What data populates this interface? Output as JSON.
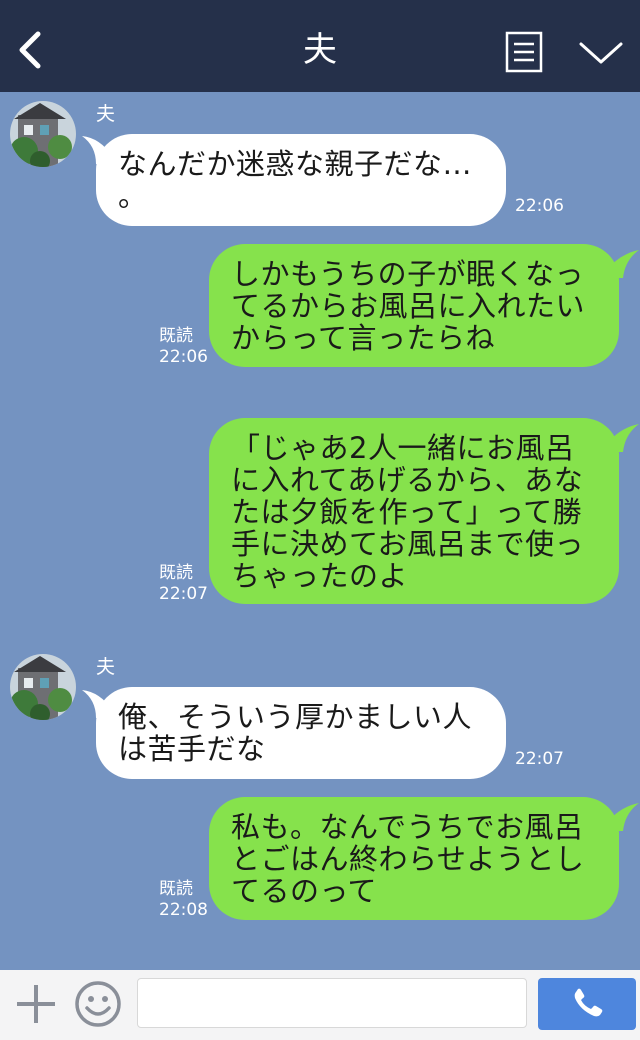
{
  "header": {
    "title": "夫"
  },
  "messages": [
    {
      "direction": "in",
      "sender": "夫",
      "text": "なんだか迷惑な親子だな…\n。",
      "time": "22:06"
    },
    {
      "direction": "out",
      "status": "既読",
      "text": "しかもうちの子が眠くなっ\nてるからお風呂に入れたい\nからって言ったらね",
      "time": "22:06"
    },
    {
      "direction": "out",
      "status": "既読",
      "text": "「じゃあ2人一緒にお風呂\nに入れてあげるから、あな\nたは夕飯を作って」って勝\n手に決めてお風呂まで使っ\nちゃったのよ",
      "time": "22:07"
    },
    {
      "direction": "in",
      "sender": "夫",
      "text": "俺、そういう厚かましい人\nは苦手だな",
      "time": "22:07"
    },
    {
      "direction": "out",
      "status": "既読",
      "text": "私も。なんでうちでお風呂\nとごはん終わらせようとし\nてるのって",
      "time": "22:08"
    }
  ],
  "composer": {
    "input_value": "",
    "placeholder": ""
  },
  "colors": {
    "header_bg": "#25304a",
    "chat_bg": "#7493c1",
    "outgoing_bubble": "#86e24c",
    "incoming_bubble": "#ffffff",
    "call_button": "#4e86dd"
  },
  "icons": [
    "back-arrow-icon",
    "menu-list-icon",
    "chevron-down-icon",
    "plus-icon",
    "emoji-icon",
    "phone-icon"
  ]
}
